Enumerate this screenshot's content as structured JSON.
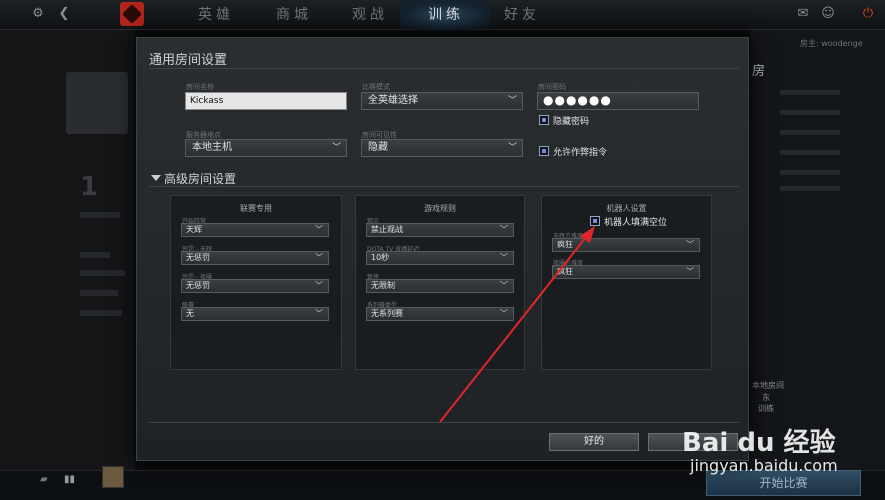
{
  "topnav": {
    "tabs": [
      {
        "label": "英雄"
      },
      {
        "label": "商城"
      },
      {
        "label": "观战"
      },
      {
        "label": "训练",
        "active": true
      },
      {
        "label": "好友"
      }
    ],
    "icons": [
      "gear-icon",
      "back-icon",
      "dota-logo-icon",
      "mail-icon",
      "user-icon",
      "power-icon"
    ]
  },
  "background": {
    "big_number": "1",
    "right_panel_title": "房",
    "right_user": "房主: woodenge",
    "right_labels": [
      "本地房间",
      "东",
      "训练"
    ],
    "start_button": "开始比赛"
  },
  "dialog": {
    "general_title": "通用房间设置",
    "fields": {
      "room_name": {
        "label": "房间名称",
        "value": "Kickass"
      },
      "game_mode": {
        "label": "比赛模式",
        "value": "全英雄选择"
      },
      "password": {
        "label": "房间密码",
        "value": "●●●●●●"
      },
      "server_location": {
        "label": "服务器地点",
        "value": "本地主机"
      },
      "visibility": {
        "label": "房间可见性",
        "value": "隐藏"
      }
    },
    "checkboxes": {
      "hide_password": "隐藏密码",
      "allow_cheats": "允许作弊指令"
    },
    "advanced_title": "高级房间设置",
    "panels": {
      "league": {
        "title": "联赛专用",
        "fields": [
          {
            "label": "开始阵营",
            "value": "天辉"
          },
          {
            "label": "惩罚 - 天辉",
            "value": "无惩罚"
          },
          {
            "label": "惩罚 - 夜魇",
            "value": "无惩罚"
          },
          {
            "label": "联赛",
            "value": "无"
          }
        ]
      },
      "rules": {
        "title": "游戏规则",
        "fields": [
          {
            "label": "观众",
            "value": "禁止观战"
          },
          {
            "label": "DOTA TV 直播延迟",
            "value": "10秒"
          },
          {
            "label": "暂停",
            "value": "无限制"
          },
          {
            "label": "系列赛类型",
            "value": "无系列赛"
          }
        ]
      },
      "bots": {
        "title": "机器人设置",
        "fill_checkbox": "机器人填满空位",
        "fields": [
          {
            "label": "天辉方难度",
            "value": "疯狂"
          },
          {
            "label": "夜魇方难度",
            "value": "疯狂"
          }
        ]
      }
    },
    "buttons": {
      "ok": "好的",
      "cancel": ""
    }
  },
  "watermark": {
    "brand": "Bai du 经验",
    "url": "jingyan.baidu.com"
  },
  "colors": {
    "accent": "#8da3c9",
    "arrow": "#e0262a",
    "logo": "#b3241a"
  }
}
